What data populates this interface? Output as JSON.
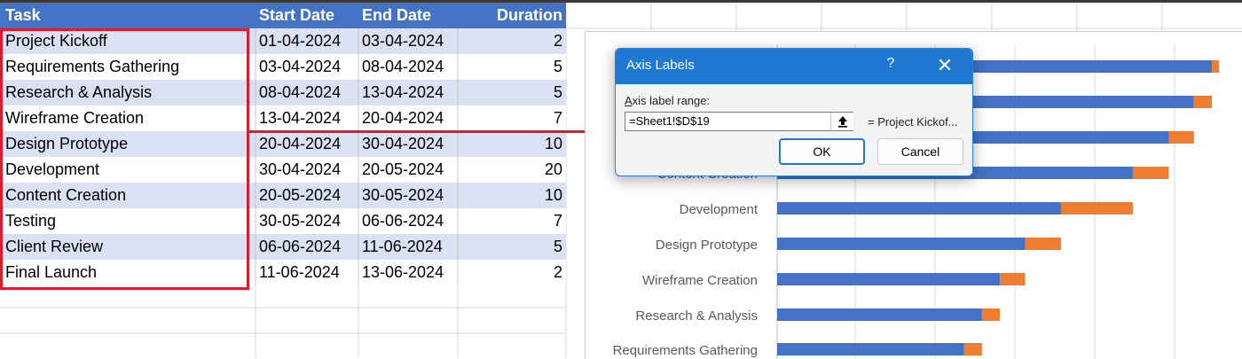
{
  "sheet": {
    "headers": [
      "Task",
      "Start Date",
      "End Date",
      "Duration"
    ],
    "rows": [
      {
        "task": "Project Kickoff",
        "start": "01-04-2024",
        "end": "03-04-2024",
        "duration": "2"
      },
      {
        "task": "Requirements Gathering",
        "start": "03-04-2024",
        "end": "08-04-2024",
        "duration": "5"
      },
      {
        "task": "Research & Analysis",
        "start": "08-04-2024",
        "end": "13-04-2024",
        "duration": "5"
      },
      {
        "task": "Wireframe Creation",
        "start": "13-04-2024",
        "end": "20-04-2024",
        "duration": "7"
      },
      {
        "task": "Design Prototype",
        "start": "20-04-2024",
        "end": "30-04-2024",
        "duration": "10"
      },
      {
        "task": "Development",
        "start": "30-04-2024",
        "end": "20-05-2024",
        "duration": "20"
      },
      {
        "task": "Content Creation",
        "start": "20-05-2024",
        "end": "30-05-2024",
        "duration": "10"
      },
      {
        "task": "Testing",
        "start": "30-05-2024",
        "end": "06-06-2024",
        "duration": "7"
      },
      {
        "task": "Client Review",
        "start": "06-06-2024",
        "end": "11-06-2024",
        "duration": "5"
      },
      {
        "task": "Final Launch",
        "start": "11-06-2024",
        "end": "13-06-2024",
        "duration": "2"
      }
    ]
  },
  "dialog": {
    "title": "Axis Labels",
    "help": "?",
    "close": "✕",
    "label_prefix": "A",
    "label_rest": "xis label range:",
    "range_value": "=Sheet1!$D$19",
    "preview": "= Project Kickof...",
    "ok": "OK",
    "cancel": "Cancel"
  },
  "colors": {
    "header": "#4472c4",
    "band": "#d9e1f2",
    "highlight": "#e0192c",
    "bar_start": "#4472c4",
    "bar_duration": "#ed7d31",
    "dialog_title": "#1f78d1"
  },
  "chart_data": {
    "type": "bar",
    "orientation": "horizontal-stacked",
    "categories_visible": [
      "Content Creation",
      "Development",
      "Design Prototype",
      "Wireframe Creation",
      "Research & Analysis",
      "Requirements Gathering"
    ],
    "series": [
      {
        "values": [
          null,
          null,
          null,
          "2024-05-20",
          "2024-04-30",
          "2024-04-20",
          "2024-04-13",
          "2024-04-08",
          "2024-04-03"
        ]
      },
      {
        "values": [
          null,
          null,
          null,
          10,
          20,
          10,
          7,
          5,
          5
        ]
      }
    ],
    "note_rows": [
      "row-0",
      "row-1",
      "row-2",
      "Content Creation",
      "Development",
      "Design Prototype",
      "Wireframe Creation",
      "Research & Analysis",
      "Requirements Gathering"
    ]
  }
}
